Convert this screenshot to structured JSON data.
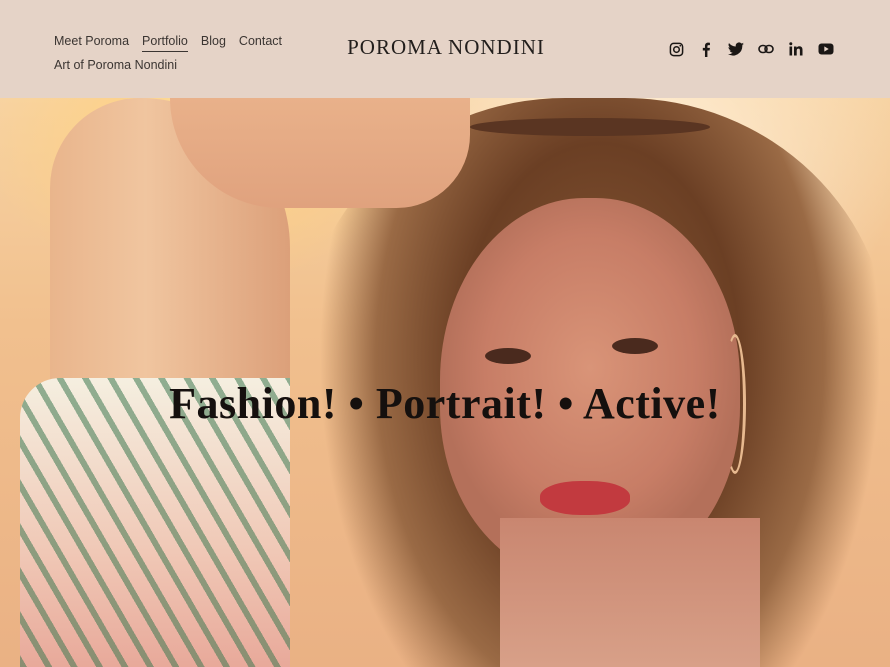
{
  "header": {
    "brand": "POROMA NONDINI",
    "nav": [
      {
        "label": "Meet Poroma",
        "active": false
      },
      {
        "label": "Portfolio",
        "active": true
      },
      {
        "label": "Blog",
        "active": false
      },
      {
        "label": "Contact",
        "active": false
      },
      {
        "label": "Art of Poroma Nondini",
        "active": false
      }
    ],
    "social": [
      "instagram-icon",
      "facebook-icon",
      "twitter-icon",
      "link-icon",
      "linkedin-icon",
      "youtube-icon"
    ]
  },
  "hero": {
    "headline": "Fashion! • Portrait! • Active!"
  },
  "colors": {
    "header_bg": "#e5d3c7",
    "text": "#3b3532",
    "headline": "#15100e"
  }
}
